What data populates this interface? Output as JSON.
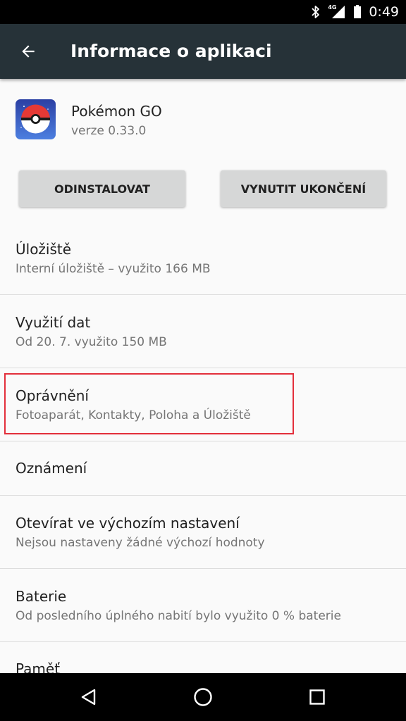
{
  "status_bar": {
    "time": "0:49",
    "network_label": "4G",
    "icons": [
      "bluetooth-icon",
      "signal-icon",
      "battery-icon"
    ]
  },
  "app_bar": {
    "title": "Informace o aplikaci",
    "back_icon": "arrow-back-icon",
    "background_color": "#263238"
  },
  "app": {
    "name": "Pokémon GO",
    "version": "verze 0.33.0",
    "icon": "pokeball-icon"
  },
  "buttons": {
    "uninstall": "ODINSTALOVAT",
    "force_stop": "VYNUTIT UKONČENÍ"
  },
  "settings": [
    {
      "title": "Úložiště",
      "summary": "Interní úložiště – využito 166 MB"
    },
    {
      "title": "Využití dat",
      "summary": "Od 20. 7. využito 150 MB"
    },
    {
      "title": "Oprávnění",
      "summary": "Fotoaparát, Kontakty, Poloha a Úložiště"
    },
    {
      "title": "Oznámení"
    },
    {
      "title": "Otevírat ve výchozím nastavení",
      "summary": "Nejsou nastaveny žádné výchozí hodnoty"
    },
    {
      "title": "Baterie",
      "summary": "Od posledního úplného nabití bylo využito 0 % baterie"
    },
    {
      "title": "Paměť"
    }
  ],
  "highlight_color": "#e32f3b",
  "nav_bar": {
    "icons": [
      "back-triangle-icon",
      "home-circle-icon",
      "recents-square-icon"
    ]
  }
}
